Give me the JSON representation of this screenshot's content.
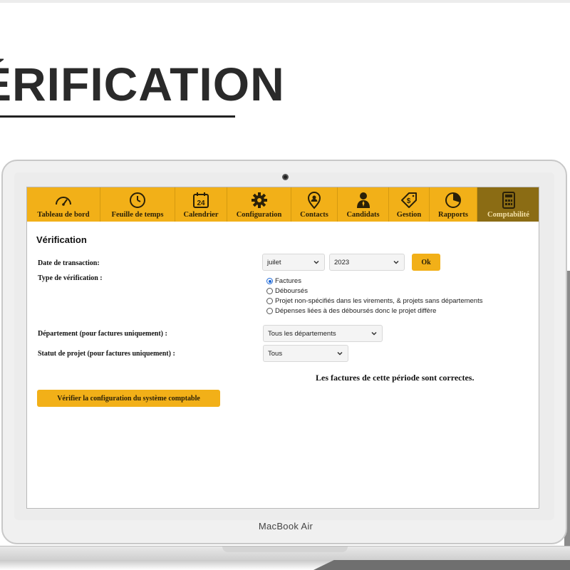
{
  "hero": {
    "title": "ÉRIFICATION"
  },
  "device": {
    "brand": "MacBook Air"
  },
  "nav": {
    "items": [
      {
        "label": "Tableau de bord",
        "icon": "gauge-icon"
      },
      {
        "label": "Feuille de temps",
        "icon": "clock-icon"
      },
      {
        "label": "Calendrier",
        "icon": "calendar-icon",
        "badge": "24"
      },
      {
        "label": "Configuration",
        "icon": "gear-icon"
      },
      {
        "label": "Contacts",
        "icon": "contact-pin-icon"
      },
      {
        "label": "Candidats",
        "icon": "candidate-icon"
      },
      {
        "label": "Gestion",
        "icon": "dollar-tag-icon"
      },
      {
        "label": "Rapports",
        "icon": "pie-chart-icon"
      },
      {
        "label": "Comptabilité",
        "icon": "calculator-icon",
        "active": true
      }
    ]
  },
  "page": {
    "title": "Vérification"
  },
  "form": {
    "date_label": "Date de transaction:",
    "month_value": "juilet",
    "year_value": "2023",
    "ok_label": "Ok",
    "type_label": "Type de vérification :",
    "type_options": [
      "Factures",
      "Déboursés",
      "Projet non-spécifiés dans les virements, & projets sans départements",
      "Dépenses liées à des déboursés donc le projet diffère"
    ],
    "type_selected": "Factures",
    "dept_label": "Département (pour factures uniquement) :",
    "dept_value": "Tous les départements",
    "status_label": "Statut de projet (pour factures uniquement) :",
    "status_value": "Tous"
  },
  "status_message": "Les factures de cette période sont correctes.",
  "verify_button": "Vérifier la configuration du système comptable",
  "colors": {
    "accent": "#f2b018",
    "active_tab": "#8b6c14",
    "radio": "#1a66d6"
  }
}
